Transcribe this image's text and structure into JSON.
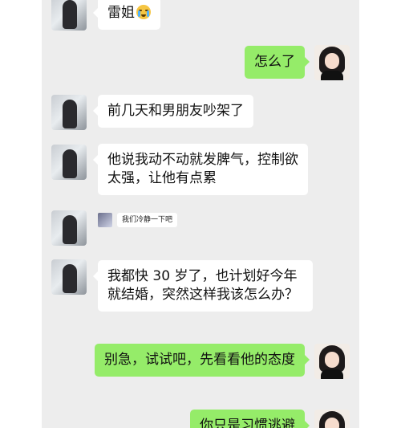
{
  "messages": [
    {
      "side": "left",
      "text": "雷姐"
    },
    {
      "side": "right",
      "text": "怎么了"
    },
    {
      "side": "left",
      "text": "前几天和男朋友吵架了"
    },
    {
      "side": "left",
      "text": "他说我动不动就发脾气，控制欲太强，让他有点累"
    },
    {
      "side": "left",
      "text": "我们冷静一下吧"
    },
    {
      "side": "left",
      "text": "我都快 30 岁了，也计划好今年就结婚，突然这样我该怎么办？"
    },
    {
      "side": "right",
      "text": "别急，试试吧，先看看他的态度"
    },
    {
      "side": "right",
      "text": "你只是习惯逃避"
    }
  ],
  "colors": {
    "chat_bg": "#ededed",
    "incoming_bubble": "#ffffff",
    "outgoing_bubble": "#95ec69"
  },
  "icons": {
    "emoji_after_first": "crying-face-emoji"
  }
}
